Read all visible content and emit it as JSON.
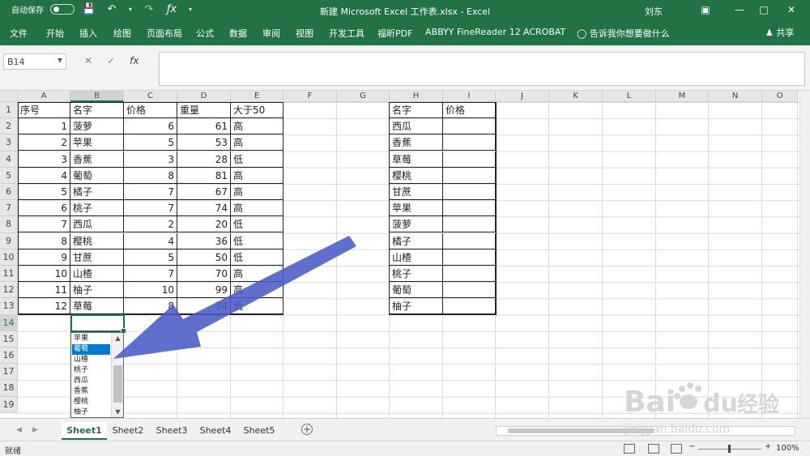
{
  "titlebar": {
    "autosave_label": "自动保存",
    "toggle_state": "关",
    "title": "新建 Microsoft Excel 工作表.xlsx  -  Excel",
    "user": "刘东"
  },
  "ribbon": {
    "tabs": [
      "文件",
      "开始",
      "插入",
      "绘图",
      "页面布局",
      "公式",
      "数据",
      "审阅",
      "视图",
      "开发工具",
      "福昕PDF",
      "ABBYY FineReader 12",
      "ACROBAT"
    ],
    "tell_me": "告诉我你想要做什么",
    "share": "共享"
  },
  "formula_bar": {
    "name_box": "B14",
    "fx": "fx",
    "value": ""
  },
  "columns": [
    "A",
    "B",
    "C",
    "D",
    "E",
    "F",
    "G",
    "H",
    "I",
    "J",
    "K",
    "L",
    "M",
    "N",
    "O"
  ],
  "rows": [
    "1",
    "2",
    "3",
    "4",
    "5",
    "6",
    "7",
    "8",
    "9",
    "10",
    "11",
    "12",
    "13",
    "14",
    "15",
    "16",
    "17",
    "18",
    "19"
  ],
  "table1": {
    "headers": [
      "序号",
      "名字",
      "价格",
      "重量",
      "大于50"
    ],
    "rows": [
      [
        "1",
        "菠萝",
        "6",
        "61",
        "高"
      ],
      [
        "2",
        "苹果",
        "5",
        "53",
        "高"
      ],
      [
        "3",
        "香蕉",
        "3",
        "28",
        "低"
      ],
      [
        "4",
        "葡萄",
        "8",
        "81",
        "高"
      ],
      [
        "5",
        "橘子",
        "7",
        "67",
        "高"
      ],
      [
        "6",
        "桃子",
        "7",
        "74",
        "高"
      ],
      [
        "7",
        "西瓜",
        "2",
        "20",
        "低"
      ],
      [
        "8",
        "樱桃",
        "4",
        "36",
        "低"
      ],
      [
        "9",
        "甘蔗",
        "5",
        "50",
        "低"
      ],
      [
        "10",
        "山楂",
        "7",
        "70",
        "高"
      ],
      [
        "11",
        "柚子",
        "10",
        "99",
        "高"
      ],
      [
        "12",
        "草莓",
        "8",
        "34",
        "低"
      ]
    ]
  },
  "table2": {
    "headers": [
      "名字",
      "价格"
    ],
    "rows": [
      [
        "西瓜",
        ""
      ],
      [
        "香蕉",
        ""
      ],
      [
        "草莓",
        ""
      ],
      [
        "樱桃",
        ""
      ],
      [
        "甘蔗",
        ""
      ],
      [
        "苹果",
        ""
      ],
      [
        "菠萝",
        ""
      ],
      [
        "橘子",
        ""
      ],
      [
        "山楂",
        ""
      ],
      [
        "桃子",
        ""
      ],
      [
        "葡萄",
        ""
      ],
      [
        "柚子",
        ""
      ]
    ]
  },
  "dropdown": {
    "items": [
      "苹果",
      "葡萄",
      "山楂",
      "桃子",
      "西瓜",
      "香蕉",
      "樱桃",
      "柚子"
    ],
    "highlighted": "葡萄"
  },
  "sheets": [
    "Sheet1",
    "Sheet2",
    "Sheet3",
    "Sheet4",
    "Sheet5"
  ],
  "active_sheet": "Sheet1",
  "statusbar": {
    "status": "就绪",
    "zoom": "100%"
  },
  "watermark": {
    "brand": "Bai",
    "brand2": "du",
    "cn": "经验",
    "url": "jingyan.baidu.com"
  },
  "colors": {
    "excel_green": "#217346",
    "arrow": "#4a5bc4",
    "highlight": "#0078d7"
  }
}
